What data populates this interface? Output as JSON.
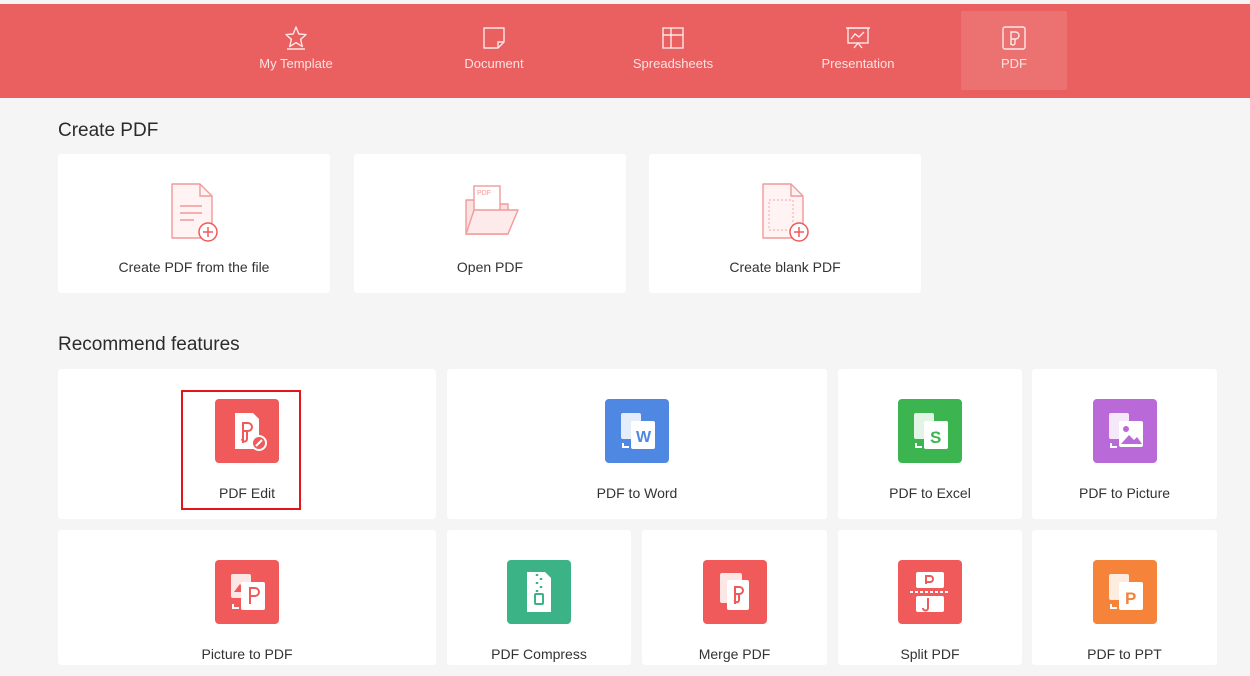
{
  "tabs": [
    {
      "label": "My Template",
      "icon": "star-icon"
    },
    {
      "label": "Document",
      "icon": "document-icon"
    },
    {
      "label": "Spreadsheets",
      "icon": "spreadsheet-icon"
    },
    {
      "label": "Presentation",
      "icon": "presentation-icon"
    },
    {
      "label": "PDF",
      "icon": "pdf-icon",
      "active": true
    }
  ],
  "create_pdf": {
    "title": "Create PDF",
    "items": [
      {
        "label": "Create PDF from the file",
        "icon": "file-plus-icon"
      },
      {
        "label": "Open PDF",
        "icon": "open-folder-icon",
        "icon_text": "PDF"
      },
      {
        "label": "Create blank PDF",
        "icon": "blank-page-plus-icon"
      }
    ]
  },
  "recommend": {
    "title": "Recommend features",
    "items": [
      {
        "label": "PDF Edit",
        "icon": "pdf-edit-icon",
        "color": "#f05a5a",
        "highlighted": true
      },
      {
        "label": "PDF to Word",
        "icon": "pdf-to-word-icon",
        "color": "#4f88e2",
        "glyph": "W"
      },
      {
        "label": "PDF to Excel",
        "icon": "pdf-to-excel-icon",
        "color": "#3cb551",
        "glyph": "S"
      },
      {
        "label": "PDF to Picture",
        "icon": "pdf-to-picture-icon",
        "color": "#b96ad8"
      },
      {
        "label": "Picture to PDF",
        "icon": "picture-to-pdf-icon",
        "color": "#f05a5a"
      },
      {
        "label": "PDF Compress",
        "icon": "pdf-compress-icon",
        "color": "#3bb386"
      },
      {
        "label": "Merge PDF",
        "icon": "merge-pdf-icon",
        "color": "#f05a5a"
      },
      {
        "label": "Split PDF",
        "icon": "split-pdf-icon",
        "color": "#f05a5a"
      },
      {
        "label": "PDF to PPT",
        "icon": "pdf-to-ppt-icon",
        "color": "#f5833a",
        "glyph": "P"
      }
    ]
  },
  "colors": {
    "topbar": "#ea5f5f",
    "accent": "#f05a5a",
    "highlight_border": "#e4141b"
  }
}
